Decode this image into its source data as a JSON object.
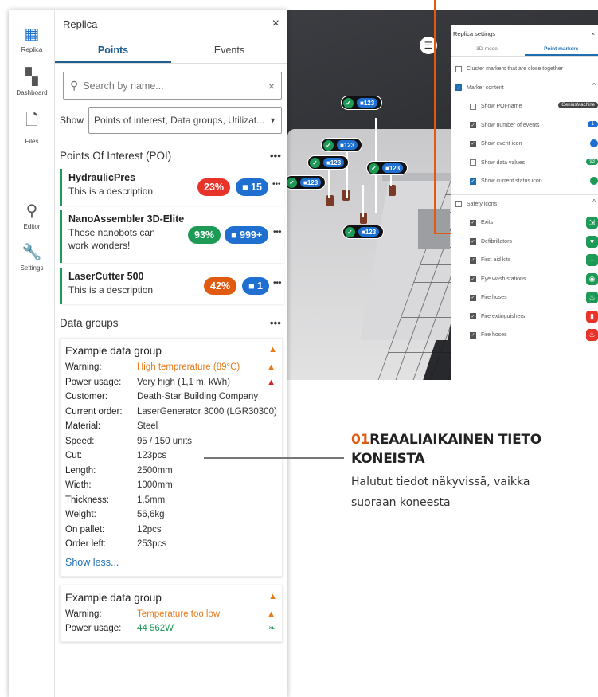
{
  "app": {
    "title": "Replica",
    "tabs": [
      {
        "label": "Points",
        "active": true
      },
      {
        "label": "Events",
        "active": false
      }
    ],
    "search_placeholder": "Search by name...",
    "show_label": "Show",
    "show_value": "Points of interest, Data groups, Utilizat...",
    "poi_heading": "Points Of Interest (POI)",
    "poi": [
      {
        "name": "HydraulicPres",
        "desc": "This is a description",
        "percent": "23%",
        "percent_color": "#e8332a",
        "events": "15"
      },
      {
        "name": "NanoAssembler 3D-Elite",
        "desc": "These nanobots can work wonders!",
        "percent": "93%",
        "percent_color": "#1c9a56",
        "events": "999+"
      },
      {
        "name": "LaserCutter 500",
        "desc": "This is a description",
        "percent": "42%",
        "percent_color": "#e05a10",
        "events": "1"
      }
    ],
    "data_groups_heading": "Data groups",
    "data_group_1": {
      "title": "Example data group",
      "rows": [
        {
          "k": "Warning:",
          "v": "High temprerature (89°C)",
          "status": "warning"
        },
        {
          "k": "Power usage:",
          "v": "Very high (1,1 m. kWh)",
          "status": "critical"
        },
        {
          "k": "Customer:",
          "v": "Death-Star Building Company"
        },
        {
          "k": "Current order:",
          "v": "LaserGenerator 3000 (LGR30300)"
        },
        {
          "k": "Material:",
          "v": "Steel"
        },
        {
          "k": "Speed:",
          "v": "95 / 150 units"
        },
        {
          "k": "Cut:",
          "v": "123pcs"
        },
        {
          "k": "Length:",
          "v": "2500mm"
        },
        {
          "k": "Width:",
          "v": "1000mm"
        },
        {
          "k": "Thickness:",
          "v": "1,5mm"
        },
        {
          "k": "Weight:",
          "v": "56,6kg"
        },
        {
          "k": "On pallet:",
          "v": "12pcs"
        },
        {
          "k": "Order left:",
          "v": "253pcs"
        }
      ],
      "show_less": "Show less..."
    },
    "data_group_2": {
      "title": "Example data group",
      "rows": [
        {
          "k": "Warning:",
          "v": "Temperature too low",
          "status": "warning"
        },
        {
          "k": "Power usage:",
          "v": "44 562W",
          "status": "ok"
        }
      ]
    }
  },
  "rail": [
    {
      "label": "Replica",
      "icon": "building-icon"
    },
    {
      "label": "Dashboard",
      "icon": "dashboard-icon"
    },
    {
      "label": "Files",
      "icon": "file-icon"
    },
    {
      "label": "Editor",
      "icon": "location-pin-icon"
    },
    {
      "label": "Settings",
      "icon": "wrench-icon"
    }
  ],
  "scene_markers": [
    {
      "events": "123"
    },
    {
      "events": "123"
    },
    {
      "events": "123"
    },
    {
      "events": "123"
    },
    {
      "events": "123"
    },
    {
      "events": "123"
    }
  ],
  "settings": {
    "title": "Replica settings",
    "tabs": [
      {
        "label": "3D-model",
        "active": false
      },
      {
        "label": "Point markers",
        "active": true
      }
    ],
    "cluster": "Cluster markers that are close together",
    "marker_content": "Marker content",
    "options": [
      {
        "label": "Show POI-name",
        "checked": false,
        "extra": "GeniusMachine"
      },
      {
        "label": "Show number of events",
        "checked": true,
        "extra": "1"
      },
      {
        "label": "Show event icon",
        "checked": true,
        "extra": ""
      },
      {
        "label": "Show data values",
        "checked": false,
        "extra": "93"
      },
      {
        "label": "Show current status icon",
        "checked": true,
        "extra": ""
      }
    ],
    "safety_icons": "Safety icons",
    "safety": [
      {
        "label": "Exits",
        "color": "#1c9a56"
      },
      {
        "label": "Defibrillators",
        "color": "#1c9a56"
      },
      {
        "label": "First aid kits",
        "color": "#1c9a56"
      },
      {
        "label": "Eye wash stations",
        "color": "#1c9a56"
      },
      {
        "label": "Fire hoses",
        "color": "#1c9a56"
      },
      {
        "label": "Fire extinguishers",
        "color": "#e8332a"
      },
      {
        "label": "Fire hoses",
        "color": "#e8332a"
      }
    ]
  },
  "callout": {
    "number": "01",
    "title_line1": "REAALIAIKAINEN TIETO",
    "title_line2": "KONEISTA",
    "body_line1": "Halutut tiedot näkyvissä, vaikka",
    "body_line2": "suoraan koneesta"
  },
  "colors": {
    "accent": "#1f5e8e",
    "brand_orange": "#e05a10",
    "ok": "#1c9a56",
    "danger": "#e8332a"
  }
}
